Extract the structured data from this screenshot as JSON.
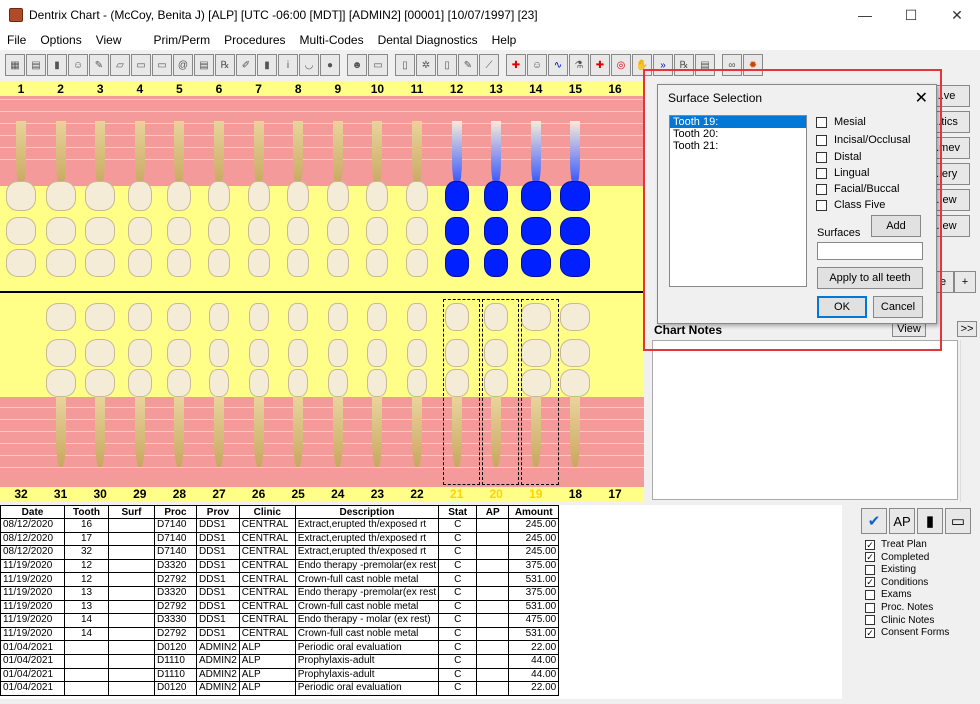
{
  "window": {
    "title": "Dentrix Chart - (McCoy, Benita J) [ALP] [UTC -06:00 [MDT]] [ADMIN2] [00001] [10/07/1997] [23]"
  },
  "menu": [
    "File",
    "Options",
    "View",
    "Prim/Perm",
    "Procedures",
    "Multi-Codes",
    "Dental Diagnostics",
    "Help"
  ],
  "upper_tooth_numbers": [
    "1",
    "2",
    "3",
    "4",
    "5",
    "6",
    "7",
    "8",
    "9",
    "10",
    "11",
    "12",
    "13",
    "14",
    "15",
    "16"
  ],
  "lower_tooth_numbers": [
    "32",
    "31",
    "30",
    "29",
    "28",
    "27",
    "26",
    "25",
    "24",
    "23",
    "22",
    "21",
    "20",
    "19",
    "18",
    "17"
  ],
  "selected_teeth": [
    "21",
    "20",
    "19"
  ],
  "right_panel": {
    "chart_notes": "Chart Notes",
    "view_label": "View",
    "plus_label": "+",
    "next_label": ">>"
  },
  "dialog": {
    "title": "Surface Selection",
    "close": "✕",
    "teeth": [
      "Tooth 19:",
      "Tooth 20:",
      "Tooth 21:"
    ],
    "surfaces": [
      "Mesial",
      "Incisal/Occlusal",
      "Distal",
      "Lingual",
      "Facial/Buccal",
      "Class Five"
    ],
    "add_label": "Add",
    "surfaces_label": "Surfaces",
    "apply_all_label": "Apply to all teeth",
    "ok_label": "OK",
    "cancel_label": "Cancel"
  },
  "grid": {
    "headers": [
      "Date",
      "Tooth",
      "Surf",
      "Proc",
      "Prov",
      "Clinic",
      "Description",
      "Stat",
      "AP",
      "Amount"
    ],
    "rows": [
      [
        "08/12/2020",
        "16",
        "",
        "D7140",
        "DDS1",
        "CENTRAL",
        "Extract,erupted th/exposed rt",
        "C",
        "",
        "245.00"
      ],
      [
        "08/12/2020",
        "17",
        "",
        "D7140",
        "DDS1",
        "CENTRAL",
        "Extract,erupted th/exposed rt",
        "C",
        "",
        "245.00"
      ],
      [
        "08/12/2020",
        "32",
        "",
        "D7140",
        "DDS1",
        "CENTRAL",
        "Extract,erupted th/exposed rt",
        "C",
        "",
        "245.00"
      ],
      [
        "11/19/2020",
        "12",
        "",
        "D3320",
        "DDS1",
        "CENTRAL",
        "Endo therapy -premolar(ex rest",
        "C",
        "",
        "375.00"
      ],
      [
        "11/19/2020",
        "12",
        "",
        "D2792",
        "DDS1",
        "CENTRAL",
        "Crown-full cast noble metal",
        "C",
        "",
        "531.00"
      ],
      [
        "11/19/2020",
        "13",
        "",
        "D3320",
        "DDS1",
        "CENTRAL",
        "Endo therapy -premolar(ex rest",
        "C",
        "",
        "375.00"
      ],
      [
        "11/19/2020",
        "13",
        "",
        "D2792",
        "DDS1",
        "CENTRAL",
        "Crown-full cast noble metal",
        "C",
        "",
        "531.00"
      ],
      [
        "11/19/2020",
        "14",
        "",
        "D3330",
        "DDS1",
        "CENTRAL",
        "Endo therapy - molar (ex rest)",
        "C",
        "",
        "475.00"
      ],
      [
        "11/19/2020",
        "14",
        "",
        "D2792",
        "DDS1",
        "CENTRAL",
        "Crown-full cast noble metal",
        "C",
        "",
        "531.00"
      ],
      [
        "01/04/2021",
        "",
        "",
        "D0120",
        "ADMIN2",
        "ALP",
        "Periodic oral evaluation",
        "C",
        "",
        "22.00"
      ],
      [
        "01/04/2021",
        "",
        "",
        "D1110",
        "ADMIN2",
        "ALP",
        "Prophylaxis-adult",
        "C",
        "",
        "44.00"
      ],
      [
        "01/04/2021",
        "",
        "",
        "D1110",
        "ADMIN2",
        "ALP",
        "Prophylaxis-adult",
        "C",
        "",
        "44.00"
      ],
      [
        "01/04/2021",
        "",
        "",
        "D0120",
        "ADMIN2",
        "ALP",
        "Periodic oral evaluation",
        "C",
        "",
        "22.00"
      ]
    ]
  },
  "filters": {
    "ap_label": "AP",
    "items": [
      {
        "label": "Treat Plan",
        "checked": true
      },
      {
        "label": "Completed",
        "checked": true
      },
      {
        "label": "Existing",
        "checked": false
      },
      {
        "label": "Conditions",
        "checked": true
      },
      {
        "label": "Exams",
        "checked": false
      },
      {
        "label": "Proc. Notes",
        "checked": false
      },
      {
        "label": "Clinic Notes",
        "checked": false
      },
      {
        "label": "Consent Forms",
        "checked": true
      }
    ]
  },
  "colors": {
    "perio_band": "#f59a9a",
    "chart_bg": "#ffff88",
    "treated": "#0020ff",
    "highlight": "#e53340"
  }
}
